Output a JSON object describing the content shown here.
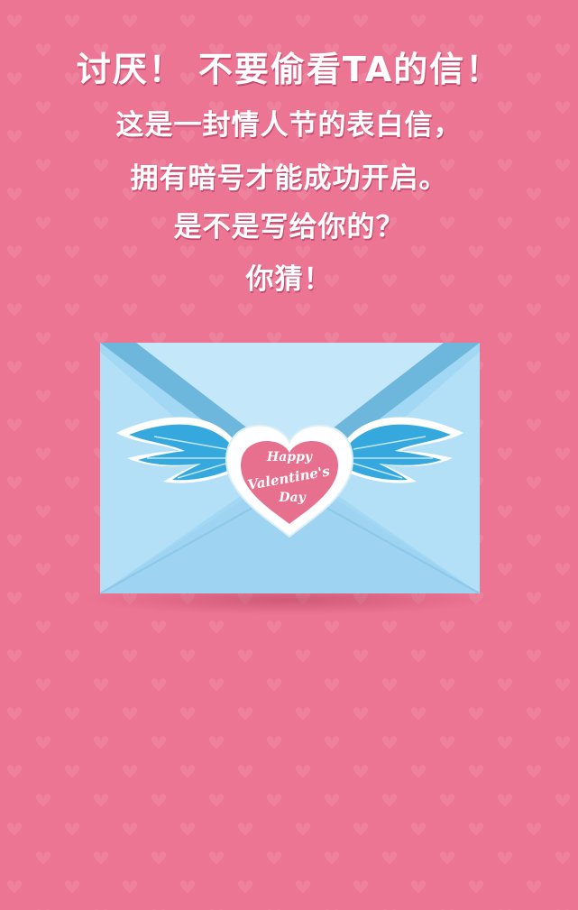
{
  "headline": {
    "title": "讨厌！ 不要偷看TA的信！",
    "line1": "这是一封情人节的表白信，",
    "line2": "拥有暗号才能成功开启。",
    "line3": "是不是写给你的？",
    "line4": "你猜！"
  },
  "envelope": {
    "seal_line1": "Happy",
    "seal_line2": "Valentine's",
    "seal_line3": "Day"
  },
  "colors": {
    "background": "#ec7593",
    "envelope": "#9fd6f2",
    "wing": "#35a9de",
    "seal": "#e8708f"
  },
  "icons": [
    "heart-pattern",
    "wing-icon",
    "heart-seal-icon"
  ]
}
